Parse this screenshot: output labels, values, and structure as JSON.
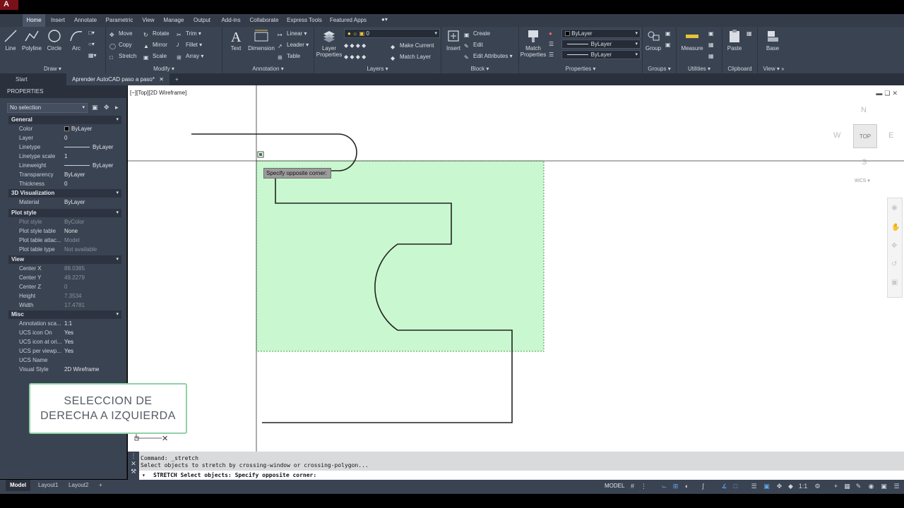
{
  "menu": {
    "tabs": [
      "Home",
      "Insert",
      "Annotate",
      "Parametric",
      "View",
      "Manage",
      "Output",
      "Add-ins",
      "Collaborate",
      "Express Tools",
      "Featured Apps"
    ],
    "active": "Home"
  },
  "ribbon": {
    "draw": {
      "label": "Draw",
      "line": "Line",
      "polyline": "Polyline",
      "circle": "Circle",
      "arc": "Arc"
    },
    "modify": {
      "label": "Modify",
      "move": "Move",
      "rotate": "Rotate",
      "trim": "Trim",
      "copy": "Copy",
      "mirror": "Mirror",
      "fillet": "Fillet",
      "stretch": "Stretch",
      "scale": "Scale",
      "array": "Array"
    },
    "annotation": {
      "label": "Annotation",
      "text": "Text",
      "dimension": "Dimension",
      "linear": "Linear",
      "leader": "Leader",
      "table": "Table"
    },
    "layers": {
      "label": "Layers",
      "layer_properties": "Layer Properties",
      "current_layer": "0",
      "make_current": "Make Current",
      "match_layer": "Match Layer"
    },
    "block": {
      "label": "Block",
      "insert": "Insert",
      "create": "Create",
      "edit": "Edit",
      "edit_attributes": "Edit Attributes"
    },
    "properties": {
      "label": "Properties",
      "match_properties": "Match Properties",
      "color": "ByLayer",
      "linetype": "ByLayer",
      "lineweight": "ByLayer"
    },
    "groups": {
      "label": "Groups",
      "group": "Group"
    },
    "utilities": {
      "label": "Utilities",
      "measure": "Measure"
    },
    "clipboard": {
      "label": "Clipboard",
      "paste": "Paste"
    },
    "view": {
      "label": "View",
      "base": "Base"
    }
  },
  "doc_tabs": [
    "Start",
    "Aprender AutoCAD paso a paso*"
  ],
  "properties_panel": {
    "title": "PROPERTIES",
    "selection": "No selection",
    "sections": [
      {
        "name": "General",
        "rows": [
          {
            "k": "Color",
            "v": "ByLayer"
          },
          {
            "k": "Layer",
            "v": "0"
          },
          {
            "k": "Linetype",
            "v": "ByLayer"
          },
          {
            "k": "Linetype scale",
            "v": "1"
          },
          {
            "k": "Lineweight",
            "v": "ByLayer"
          },
          {
            "k": "Transparency",
            "v": "ByLayer"
          },
          {
            "k": "Thickness",
            "v": "0"
          }
        ]
      },
      {
        "name": "3D Visualization",
        "rows": [
          {
            "k": "Material",
            "v": "ByLayer"
          }
        ]
      },
      {
        "name": "Plot style",
        "rows": [
          {
            "k": "Plot style",
            "v": "ByColor"
          },
          {
            "k": "Plot style table",
            "v": "None"
          },
          {
            "k": "Plot table attac...",
            "v": "Model"
          },
          {
            "k": "Plot table type",
            "v": "Not available"
          }
        ]
      },
      {
        "name": "View",
        "rows": [
          {
            "k": "Center X",
            "v": "88.0385"
          },
          {
            "k": "Center Y",
            "v": "49.2279"
          },
          {
            "k": "Center Z",
            "v": "0"
          },
          {
            "k": "Height",
            "v": "7.3534"
          },
          {
            "k": "Width",
            "v": "17.4781"
          }
        ]
      },
      {
        "name": "Misc",
        "rows": [
          {
            "k": "Annotation sca...",
            "v": "1:1"
          },
          {
            "k": "UCS icon On",
            "v": "Yes"
          },
          {
            "k": "UCS icon at ori...",
            "v": "Yes"
          },
          {
            "k": "UCS per viewp...",
            "v": "Yes"
          },
          {
            "k": "UCS Name",
            "v": ""
          },
          {
            "k": "Visual Style",
            "v": "2D Wireframe"
          }
        ]
      }
    ]
  },
  "viewport": {
    "label": "[−][Top][2D Wireframe]",
    "tooltip": "Specify opposite corner:"
  },
  "viewcube": {
    "n": "N",
    "s": "S",
    "e": "E",
    "w": "W",
    "top": "TOP",
    "wcs": "WCS"
  },
  "overlay": {
    "line1": "SELECCION DE",
    "line2": "DERECHA A IZQUIERDA"
  },
  "command": {
    "history1": "Command: _stretch",
    "history2": "Select objects to stretch by crossing-window or crossing-polygon...",
    "prompt": "STRETCH Select objects: Specify opposite corner:"
  },
  "status": {
    "layouts": [
      "Model",
      "Layout1",
      "Layout2"
    ],
    "model": "MODEL",
    "scale": "1:1"
  },
  "colors": {
    "selection_fill": "#c9f7cf",
    "ribbon_bg": "#3a4352",
    "canvas_bg": "#ffffff"
  }
}
